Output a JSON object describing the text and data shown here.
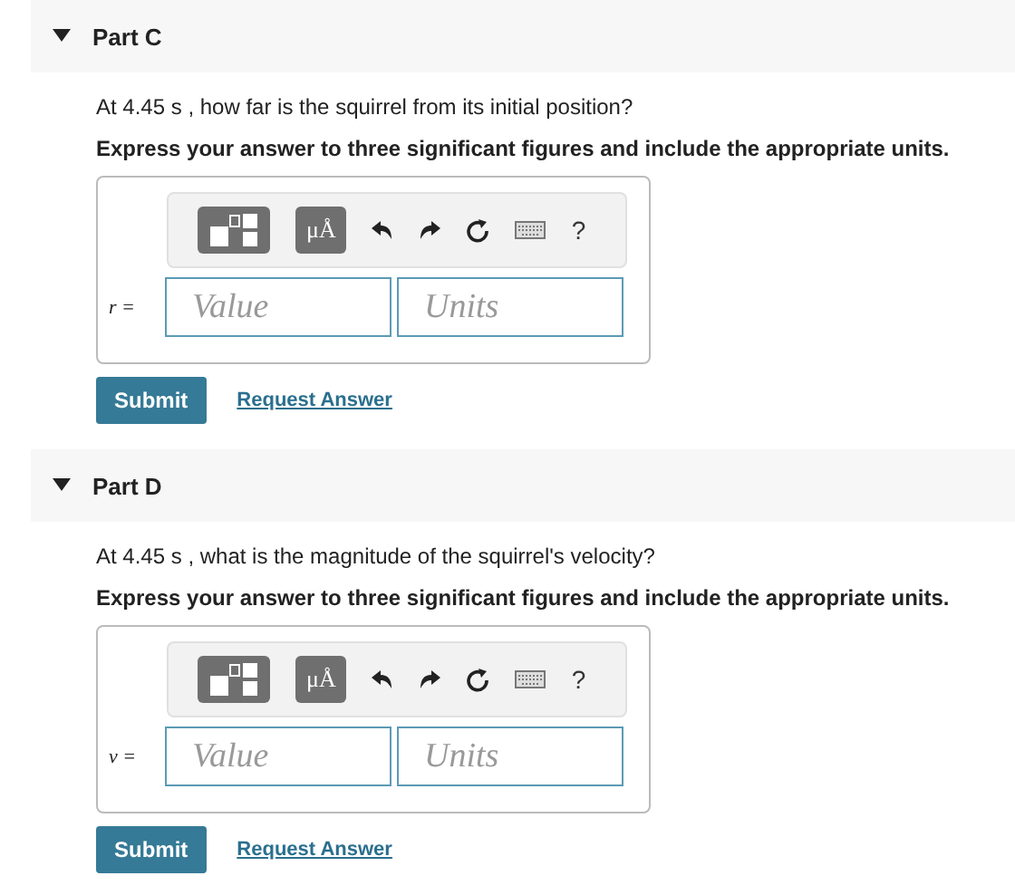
{
  "parts": [
    {
      "title": "Part C",
      "expanded": true,
      "question": "At 4.45 s , how far is the squirrel from its initial position?",
      "instruction": "Express your answer to three significant figures and include the appropriate units.",
      "toolbar": {
        "units_label": "μÅ",
        "help": "?"
      },
      "answer": {
        "label": "r =",
        "value_placeholder": "Value",
        "units_placeholder": "Units"
      },
      "submit": "Submit",
      "request": "Request Answer"
    },
    {
      "title": "Part D",
      "expanded": true,
      "question": "At 4.45 s , what is the magnitude of the squirrel's velocity?",
      "instruction": "Express your answer to three significant figures and include the appropriate units.",
      "toolbar": {
        "units_label": "μÅ",
        "help": "?"
      },
      "answer": {
        "label": "v =",
        "value_placeholder": "Value",
        "units_placeholder": "Units"
      },
      "submit": "Submit",
      "request": "Request Answer"
    }
  ]
}
